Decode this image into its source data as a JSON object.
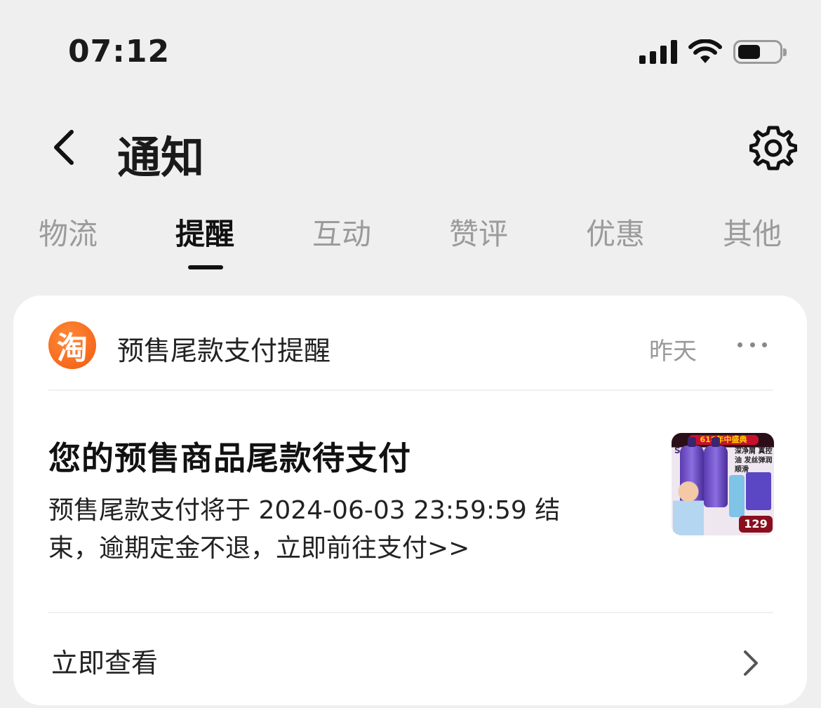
{
  "status_bar": {
    "time": "07:12",
    "icons": [
      "cellular-signal-icon",
      "wifi-icon",
      "battery-icon"
    ]
  },
  "nav": {
    "title": "通知",
    "back_icon": "chevron-left-icon",
    "settings_icon": "gear-icon"
  },
  "tabs": [
    {
      "label": "物流",
      "active": false
    },
    {
      "label": "提醒",
      "active": true
    },
    {
      "label": "互动",
      "active": false
    },
    {
      "label": "赞评",
      "active": false
    },
    {
      "label": "优惠",
      "active": false
    },
    {
      "label": "其他",
      "active": false
    }
  ],
  "notification": {
    "app_logo_text": "淘",
    "source_title": "预售尾款支付提醒",
    "time": "昨天",
    "message_title": "您的预售商品尾款待支付",
    "message_body": "预售尾款支付将于 2024-06-03 23:59:59 结束，逾期定金不退，立即前往支付>>",
    "thumbnail": {
      "banner": "618年中盛典",
      "brand": "Spēs",
      "ad_text": "深净屑 真控油 发丝弹润顺滑",
      "price": "129"
    },
    "action_label": "立即查看"
  },
  "colors": {
    "background": "#efefef",
    "card": "#ffffff",
    "brand_orange": "#f25a0f",
    "inactive_tab": "#9b9b9b"
  }
}
